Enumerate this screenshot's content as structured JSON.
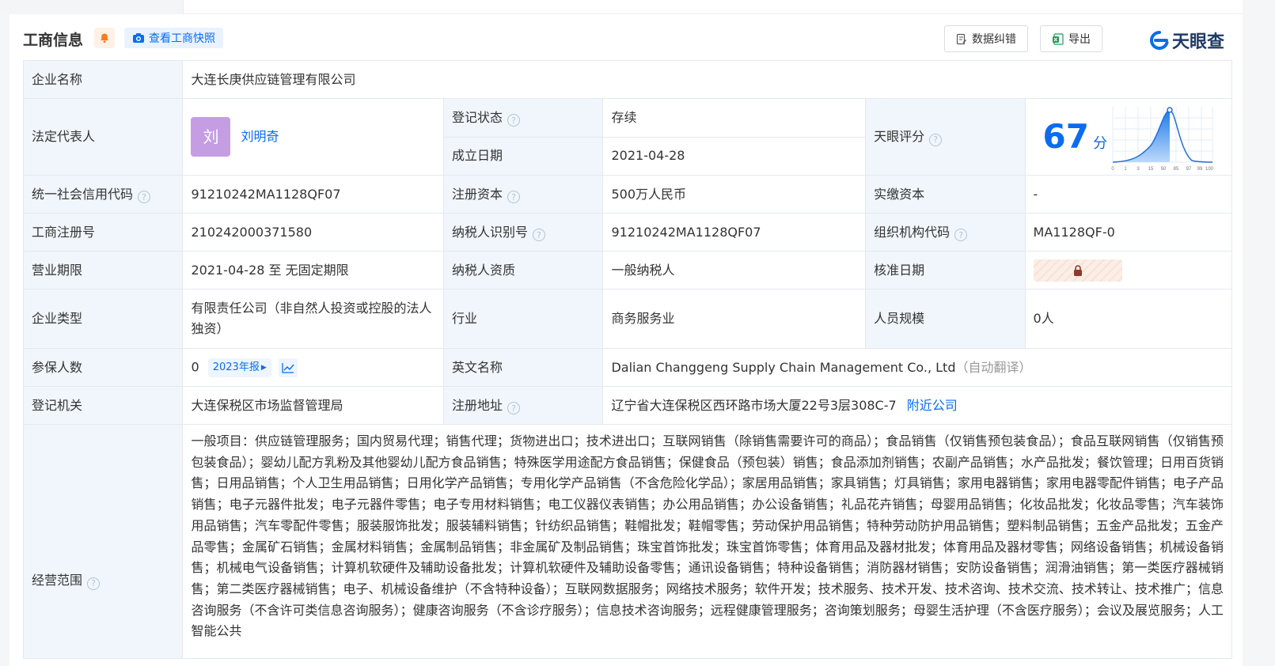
{
  "header": {
    "title": "工商信息",
    "snapshot_label": "查看工商快照",
    "correct_label": "数据纠错",
    "export_label": "导出",
    "logo_text": "天眼查"
  },
  "rows": {
    "company_name": {
      "label": "企业名称",
      "value": "大连长庚供应链管理有限公司"
    },
    "legal_rep": {
      "label": "法定代表人",
      "avatar_char": "刘",
      "name": "刘明奇"
    },
    "reg_status": {
      "label": "登记状态",
      "value": "存续"
    },
    "found_date": {
      "label": "成立日期",
      "value": "2021-04-28"
    },
    "score": {
      "label": "天眼评分",
      "value": "67",
      "unit": "分",
      "axis_ticks": [
        "0",
        "1",
        "3",
        "15",
        "50",
        "85",
        "97",
        "99",
        "100"
      ]
    },
    "credit_code": {
      "label": "统一社会信用代码",
      "value": "91210242MA1128QF07"
    },
    "reg_capital": {
      "label": "注册资本",
      "value": "500万人民币"
    },
    "paid_capital": {
      "label": "实缴资本",
      "value": "-"
    },
    "reg_no": {
      "label": "工商注册号",
      "value": "210242000371580"
    },
    "taxpayer_id": {
      "label": "纳税人识别号",
      "value": "91210242MA1128QF07"
    },
    "org_code": {
      "label": "组织机构代码",
      "value": "MA1128QF-0"
    },
    "biz_term": {
      "label": "营业期限",
      "value": "2021-04-28 至 无固定期限"
    },
    "taxpayer_qual": {
      "label": "纳税人资质",
      "value": "一般纳税人"
    },
    "approve_date": {
      "label": "核准日期"
    },
    "company_type": {
      "label": "企业类型",
      "value": "有限责任公司（非自然人投资或控股的法人独资）"
    },
    "industry": {
      "label": "行业",
      "value": "商务服务业"
    },
    "staff_size": {
      "label": "人员规模",
      "value": "0人"
    },
    "insured": {
      "label": "参保人数",
      "value": "0",
      "report_tag": "2023年报"
    },
    "english_name": {
      "label": "英文名称",
      "value": "Dalian Changgeng Supply Chain Management Co., Ltd",
      "note": "（自动翻译）"
    },
    "reg_authority": {
      "label": "登记机关",
      "value": "大连保税区市场监督管理局"
    },
    "reg_address": {
      "label": "注册地址",
      "value": "辽宁省大连保税区西环路市场大厦22号3层308C-7",
      "nearby": "附近公司"
    },
    "biz_scope": {
      "label": "经营范围",
      "value": "一般项目：供应链管理服务；国内贸易代理；销售代理；货物进出口；技术进出口；互联网销售（除销售需要许可的商品）；食品销售（仅销售预包装食品）；食品互联网销售（仅销售预包装食品）；婴幼儿配方乳粉及其他婴幼儿配方食品销售；特殊医学用途配方食品销售；保健食品（预包装）销售；食品添加剂销售；农副产品销售；水产品批发；餐饮管理；日用百货销售；日用品销售；个人卫生用品销售；日用化学产品销售；专用化学产品销售（不含危险化学品）；家居用品销售；家具销售；灯具销售；家用电器销售；家用电器零配件销售；电子产品销售；电子元器件批发；电子元器件零售；电子专用材料销售；电工仪器仪表销售；办公用品销售；办公设备销售；礼品花卉销售；母婴用品销售；化妆品批发；化妆品零售；汽车装饰用品销售；汽车零配件零售；服装服饰批发；服装辅料销售；针纺织品销售；鞋帽批发；鞋帽零售；劳动保护用品销售；特种劳动防护用品销售；塑料制品销售；五金产品批发；五金产品零售；金属矿石销售；金属材料销售；金属制品销售；非金属矿及制品销售；珠宝首饰批发；珠宝首饰零售；体育用品及器材批发；体育用品及器材零售；网络设备销售；机械设备销售；机械电气设备销售；计算机软硬件及辅助设备批发；计算机软硬件及辅助设备零售；通讯设备销售；特种设备销售；消防器材销售；安防设备销售；润滑油销售；第一类医疗器械销售；第二类医疗器械销售；电子、机械设备维护（不含特种设备）；互联网数据服务；网络技术服务；软件开发；技术服务、技术开发、技术咨询、技术交流、技术转让、技术推广；信息咨询服务（不含许可类信息咨询服务）；健康咨询服务（不含诊疗服务）；信息技术咨询服务；远程健康管理服务；咨询策划服务；母婴生活护理（不含医疗服务）；会议及展览服务；人工智能公共"
    }
  },
  "colors": {
    "accent": "#0a6cf0",
    "label_bg": "#f0f6fc",
    "status_green": "#19a15f"
  }
}
